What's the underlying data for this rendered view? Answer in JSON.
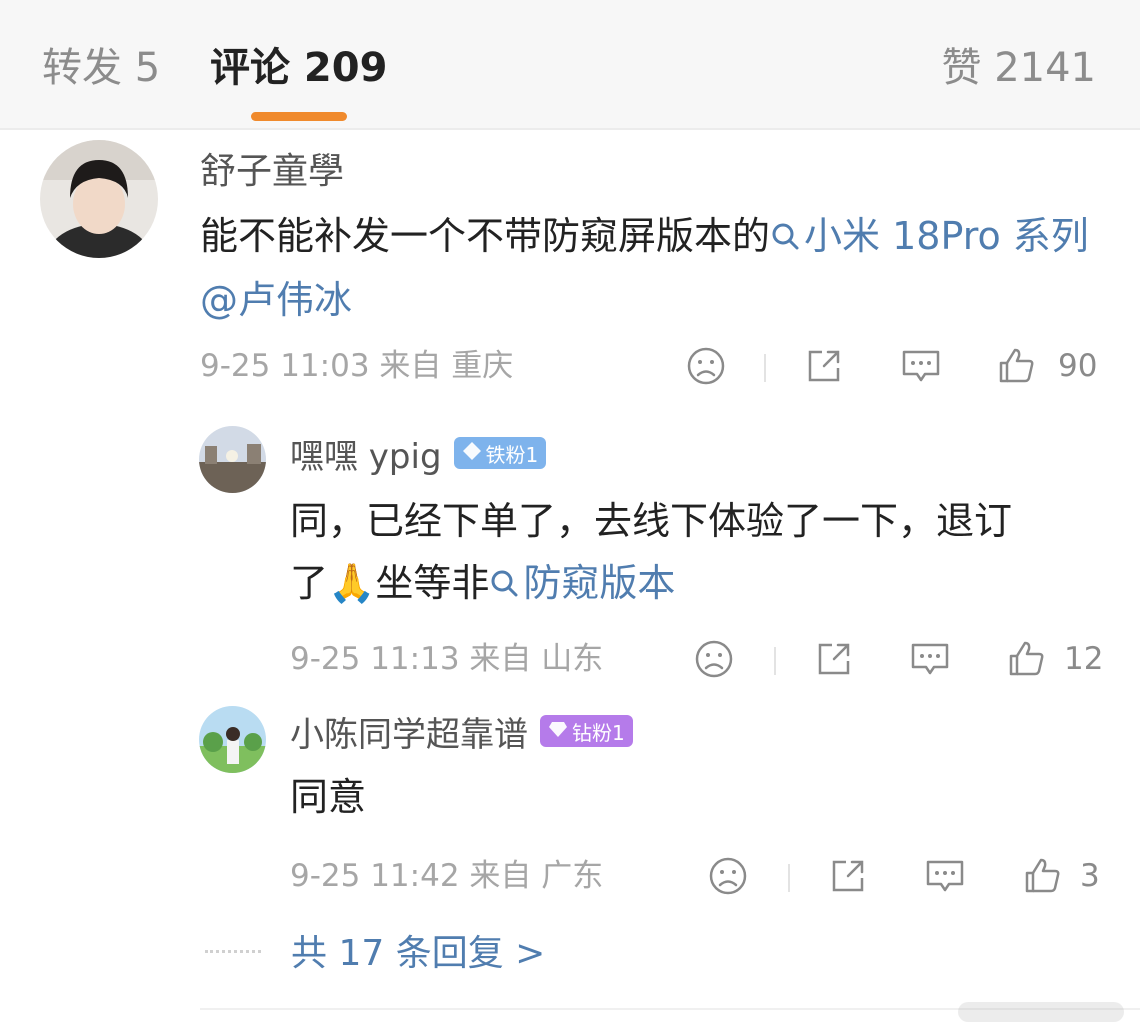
{
  "tabs": {
    "reposts": "转发 5",
    "comments": "评论 209",
    "likes": "赞 2141"
  },
  "comments": [
    {
      "username": "舒子童學",
      "text_before": "能不能补发一个不带防窥屏版本的",
      "topic_link": "小米 18Pro 系列",
      "mention": "@卢伟冰",
      "meta": "9-25 11:03 来自 重庆",
      "likes": "90"
    },
    {
      "username": "嘿嘿 ypig",
      "badge": "铁粉1",
      "text_line1": "同，已经下单了，去线下体验了一下，退订",
      "text_before": "了",
      "emoji": "🙏",
      "text_after": "坐等非",
      "topic_link": "防窥版本",
      "meta": "9-25 11:13 来自 山东",
      "likes": "12"
    },
    {
      "username": "小陈同学超靠谱",
      "badge": "钻粉1",
      "text": "同意",
      "meta": "9-25 11:42 来自 广东",
      "likes": "3"
    }
  ],
  "more_replies": "共 17 条回复 >",
  "icons": [
    "sad-face-icon",
    "share-icon",
    "comment-icon",
    "thumbs-up-icon",
    "search-icon",
    "diamond-icon"
  ],
  "colors": {
    "accent": "#f08a2c",
    "link": "#507daf",
    "badge_iron": "#7eb3ec",
    "badge_diamond": "#b57bea",
    "meta": "#a6a6a6"
  }
}
